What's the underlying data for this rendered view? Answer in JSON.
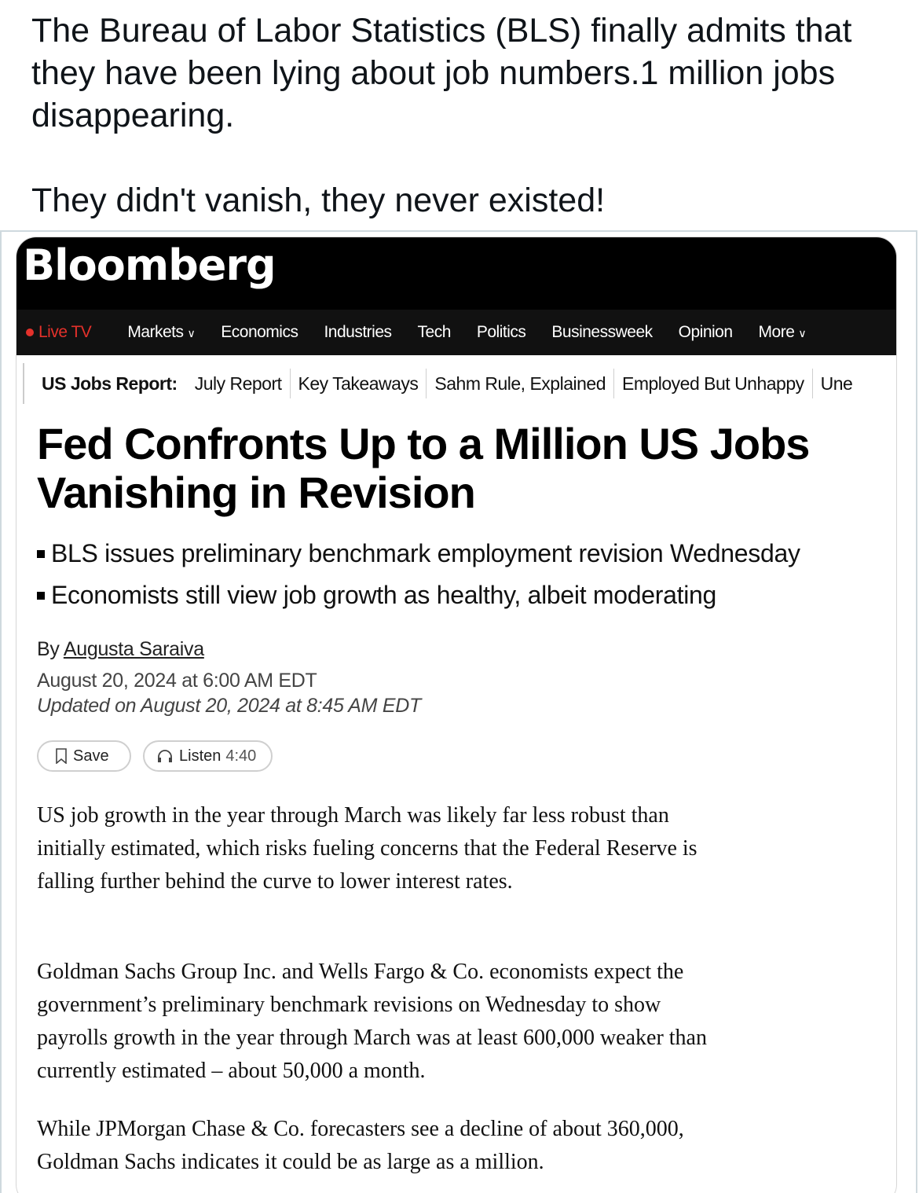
{
  "post": {
    "line1": "The Bureau of Labor Statistics (BLS) finally admits that they have been lying about job numbers.1 million jobs disappearing.",
    "line2": "They didn't vanish, they never existed!"
  },
  "bloomberg": {
    "logo": "Bloomberg",
    "nav": {
      "live": "Live TV",
      "markets": "Markets",
      "economics": "Economics",
      "industries": "Industries",
      "tech": "Tech",
      "politics": "Politics",
      "businessweek": "Businessweek",
      "opinion": "Opinion",
      "more": "More"
    },
    "sub_nav": {
      "lead": "US Jobs Report:",
      "items": [
        "July Report",
        "Key Takeaways",
        "Sahm Rule, Explained",
        "Employed But Unhappy",
        "Une"
      ]
    }
  },
  "article": {
    "headline": "Fed Confronts Up to a Million US Jobs Vanishing in Revision",
    "bullets": [
      "BLS issues preliminary benchmark employment revision Wednesday",
      "Economists still view job growth as healthy, albeit moderating"
    ],
    "by": "By",
    "author": "Augusta Saraiva",
    "published": "August 20, 2024 at 6:00 AM EDT",
    "updated": "Updated on August 20, 2024 at 8:45 AM EDT",
    "save_label": "Save",
    "listen_label": "Listen",
    "listen_duration": "4:40",
    "paragraphs": [
      "US job growth in the year through March was likely far less robust than initially estimated, which risks fueling concerns that the Federal Reserve is falling further behind the curve to lower interest rates.",
      "Goldman Sachs Group Inc. and Wells Fargo & Co. economists expect the government’s preliminary benchmark revisions on Wednesday to show payrolls growth in the year through March was at least 600,000 weaker than currently estimated – about 50,000 a month.",
      "While JPMorgan Chase & Co. forecasters see a decline of about 360,000, Goldman Sachs indicates it could be as large as a million."
    ]
  },
  "colors": {
    "live_red": "#e4312b",
    "nav_bg": "#111111",
    "logo_bar": "#000000"
  }
}
